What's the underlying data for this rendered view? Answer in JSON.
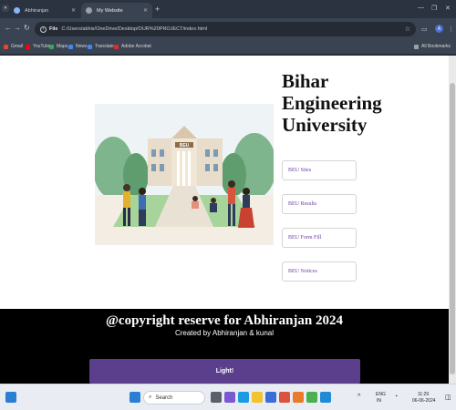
{
  "browser": {
    "tabs": [
      {
        "title": "Abhiranjan"
      },
      {
        "title": "My Website"
      }
    ],
    "new_tab": "+",
    "url_scheme": "File",
    "url": "C:/Users/abhis/OneDrive/Desktop/OUR%20PROJECT/index.html",
    "profile_initial": "A",
    "bookmarks": [
      {
        "label": "Gmail",
        "color": "#ea4335"
      },
      {
        "label": "YouTube",
        "color": "#ff0000"
      },
      {
        "label": "Maps",
        "color": "#34a853"
      },
      {
        "label": "News",
        "color": "#4285f4"
      },
      {
        "label": "Translate",
        "color": "#4285f4"
      },
      {
        "label": "Adobe Acrobat",
        "color": "#d93025"
      }
    ],
    "all_bookmarks": "All Bookmarks"
  },
  "page": {
    "university_title": "Bihar Engineering University",
    "hero_sign": "BEU",
    "links": [
      {
        "label": "BEU Sites"
      },
      {
        "label": "BEU Results"
      },
      {
        "label": "BEU Form Fill"
      },
      {
        "label": "BEU Notices"
      }
    ],
    "footer": {
      "title": "@copyright reserve for Abhiranjan 2024",
      "subtitle": "Created by Abhiranjan & kunal",
      "button_label": "Light!"
    },
    "accent_color": "#5b3f8c"
  },
  "taskbar": {
    "search_placeholder": "Search",
    "language": "ENG",
    "region": "IN",
    "time": "11:29",
    "date": "06-06-2024"
  }
}
